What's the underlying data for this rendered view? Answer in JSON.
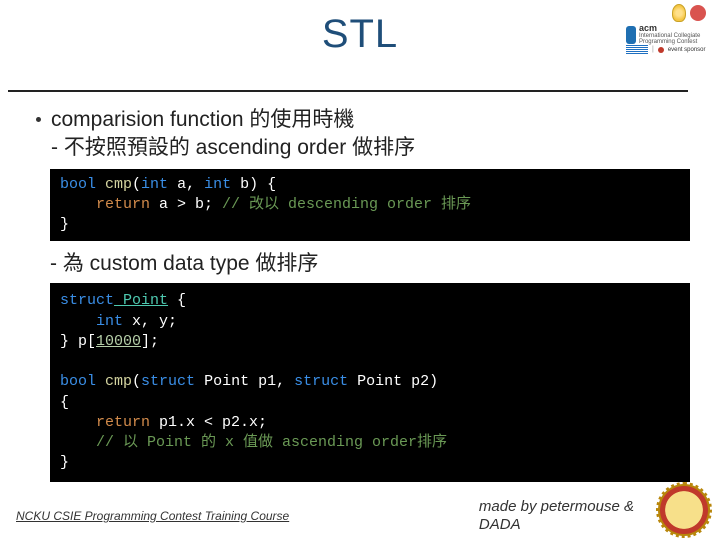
{
  "title": "STL",
  "logos": {
    "acm_label": "acm",
    "acm_sub": "International Collegiate\nProgramming Contest",
    "ibm": "IBM.",
    "sponsor": "event\nsponsor"
  },
  "bullet1": "comparision function 的使用時機",
  "bullet1_sub": "- 不按照預設的 ascending order 做排序",
  "code1": {
    "l1_a": "bool",
    "l1_b": " cmp",
    "l1_c": "(",
    "l1_d": "int",
    "l1_e": " a, ",
    "l1_f": "int",
    "l1_g": " b) {",
    "l2_a": "    return",
    "l2_b": " a > b; ",
    "l2_c": "// 改以 descending order 排序",
    "l3": "}"
  },
  "bullet2": "- 為 custom data type 做排序",
  "code2": {
    "l1_a": "struct",
    "l1_b": " Point",
    "l1_c": " {",
    "l2_a": "    int",
    "l2_b": " x, y;",
    "l3_a": "} p[",
    "l3_b": "10000",
    "l3_c": "];",
    "blank": "",
    "l4_a": "bool",
    "l4_b": " cmp",
    "l4_c": "(",
    "l4_d": "struct",
    "l4_e": " Point p1, ",
    "l4_f": "struct",
    "l4_g": " Point p2)",
    "l5": "{",
    "l6_a": "    return",
    "l6_b": " p1.x < p2.x;",
    "l7": "    // 以 Point 的 x 值做 ascending order排序",
    "l8": "}"
  },
  "footer_left": " NCKU CSIE Programming Contest Training Course ",
  "footer_right_1": "made by petermouse &",
  "footer_right_2": "DADA"
}
